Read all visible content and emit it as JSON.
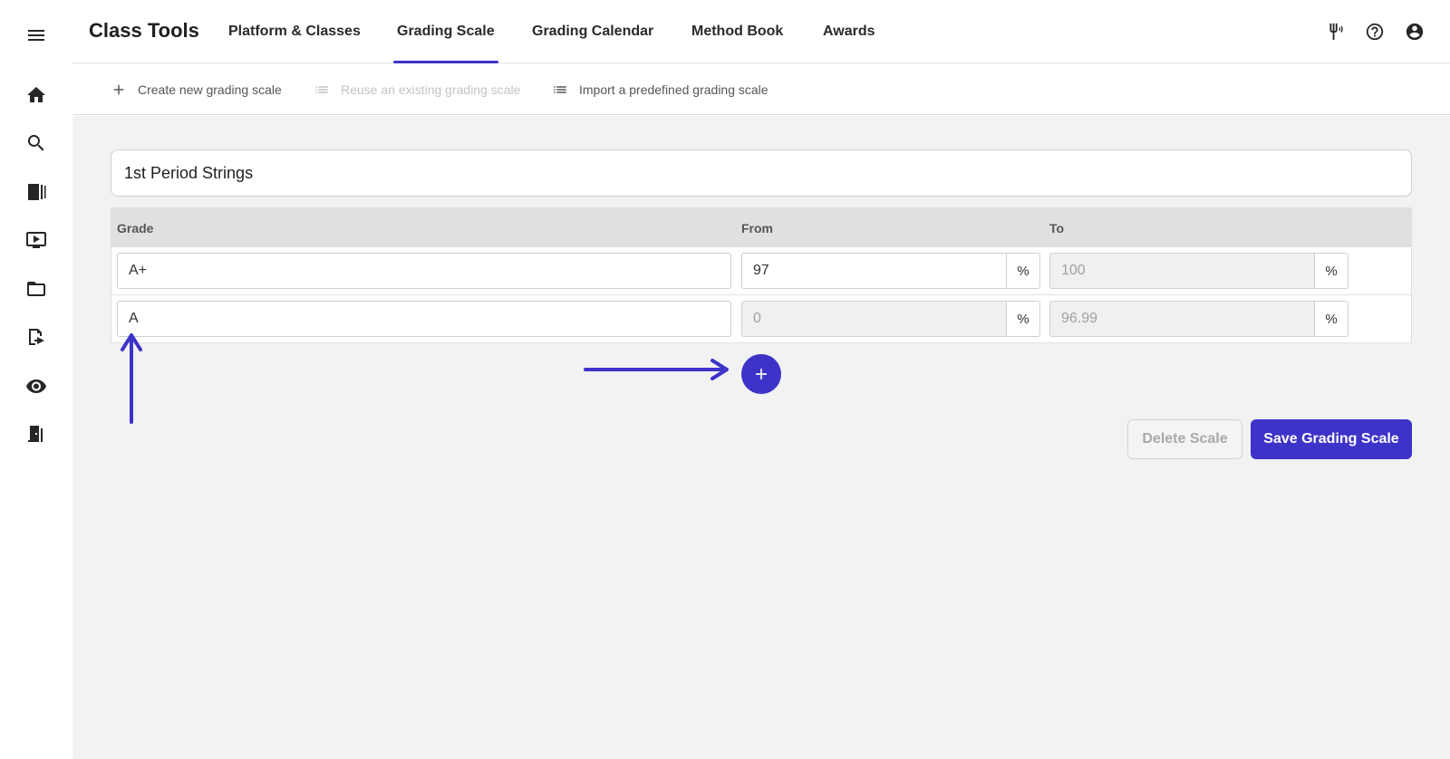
{
  "app": {
    "title": "Class Tools"
  },
  "tabs": [
    {
      "label": "Platform & Classes",
      "active": false
    },
    {
      "label": "Grading Scale",
      "active": true
    },
    {
      "label": "Grading Calendar",
      "active": false
    },
    {
      "label": "Method Book",
      "active": false
    },
    {
      "label": "Awards",
      "active": false
    }
  ],
  "header_icons": [
    "tuning-fork-icon",
    "help-circle-icon",
    "account-circle-icon"
  ],
  "sidebar": {
    "icons": [
      "menu-icon",
      "home-icon",
      "search-icon",
      "library-icon",
      "video-icon",
      "folder-icon",
      "assignment-icon",
      "eye-icon",
      "exit-door-icon"
    ]
  },
  "actions": {
    "create_label": "Create new grading scale",
    "reuse_label": "Reuse an existing grading scale",
    "import_label": "Import a predefined grading scale"
  },
  "scale": {
    "name": "1st Period Strings",
    "columns": {
      "grade": "Grade",
      "from": "From",
      "to": "To"
    },
    "rows": [
      {
        "grade": "A+",
        "from": "97",
        "to": "100",
        "unit": "%"
      },
      {
        "grade": "A",
        "from": "0",
        "to": "96.99",
        "unit": "%"
      }
    ]
  },
  "buttons": {
    "delete_label": "Delete Scale",
    "save_label": "Save Grading Scale"
  },
  "colors": {
    "accent": "#3d33c9",
    "content_bg": "#f2f2f2",
    "table_header_bg": "#e0e0e0"
  }
}
